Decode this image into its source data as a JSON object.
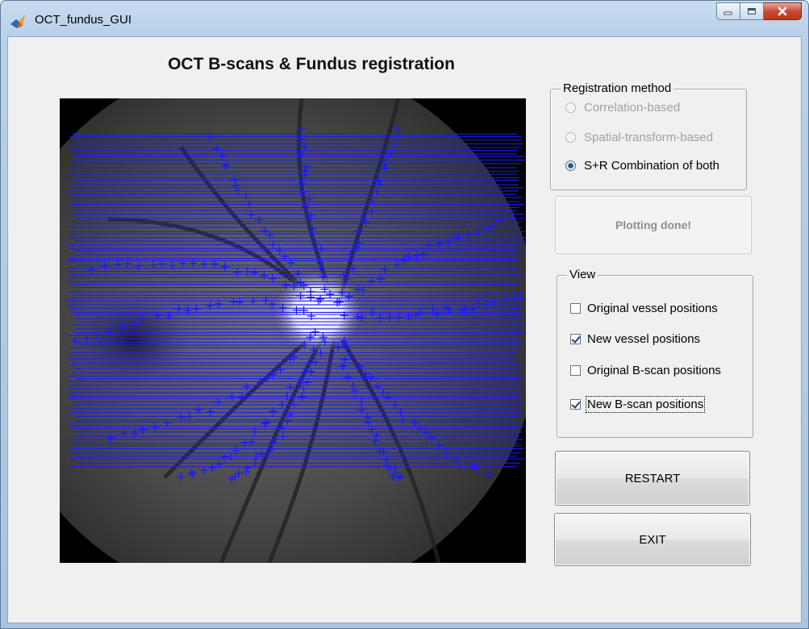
{
  "window": {
    "title": "OCT_fundus_GUI"
  },
  "heading": "OCT B-scans & Fundus registration",
  "registration": {
    "legend": "Registration method",
    "options": [
      {
        "label": "Correlation-based",
        "selected": false,
        "enabled": false
      },
      {
        "label": "Spatial-transform-based",
        "selected": false,
        "enabled": false
      },
      {
        "label": "S+R Combination of both",
        "selected": true,
        "enabled": true
      }
    ]
  },
  "status": {
    "text": "Plotting done!"
  },
  "view": {
    "legend": "View",
    "checkboxes": [
      {
        "label": "Original vessel positions",
        "checked": false
      },
      {
        "label": "New vessel positions",
        "checked": true
      },
      {
        "label": "Original B-scan positions",
        "checked": false
      },
      {
        "label": "New B-scan positions",
        "checked": true
      }
    ]
  },
  "buttons": {
    "restart": "RESTART",
    "exit": "EXIT"
  },
  "colors": {
    "overlay": "#1a1aff",
    "accent": "#1c5a8e"
  },
  "plot": {
    "bscan_count": 100
  }
}
